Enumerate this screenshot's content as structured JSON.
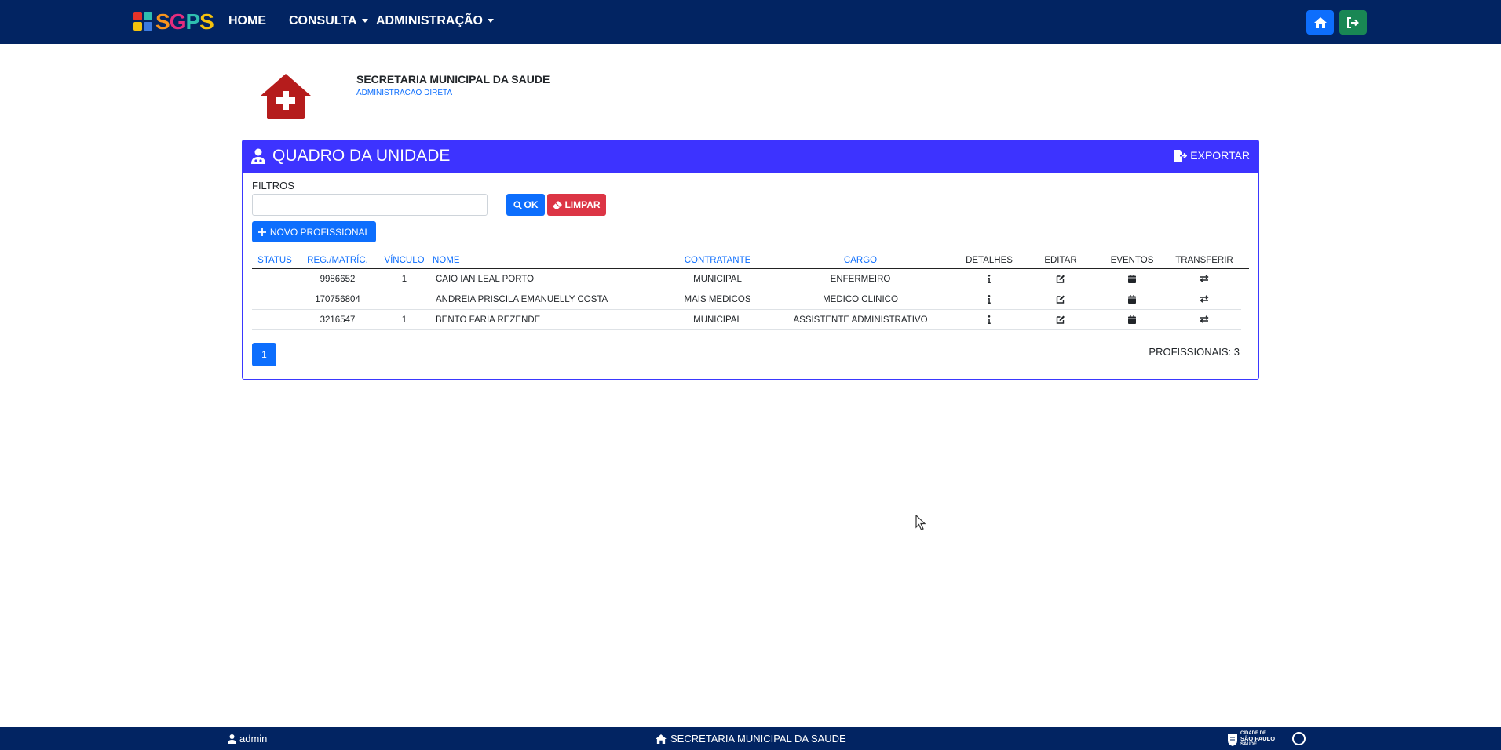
{
  "brand": {
    "name": "SGPS",
    "letter_colors": [
      "#f7941d",
      "#e52d7d",
      "#2fbfb0",
      "#f4c20d"
    ],
    "mark_colors": [
      "#e63329",
      "#2fbfb0",
      "#f4c20d",
      "#3d7be0"
    ]
  },
  "nav": {
    "home_label": "HOME",
    "consulta_label": "CONSULTA",
    "admin_label": "ADMINISTRAÇÃO",
    "home_button_color": "#0d6efd",
    "logout_button_color": "#198754"
  },
  "org": {
    "name": "SECRETARIA MUNICIPAL DA SAUDE",
    "subtitle": "ADMINISTRACAO DIRETA",
    "icon": "hospital-house-icon",
    "icon_color": "#b51c1c"
  },
  "panel": {
    "title": "QUADRO DA UNIDADE",
    "export_label": "EXPORTAR",
    "header_color": "#3d33ff"
  },
  "filters": {
    "label": "FILTROS",
    "value": "",
    "ok_label": "OK",
    "clear_label": "LIMPAR",
    "new_label": "NOVO PROFISSIONAL"
  },
  "table": {
    "headers": {
      "status": "STATUS",
      "reg": "REG./MATRÍC.",
      "vinculo": "VÍNCULO",
      "nome": "NOME",
      "contratante": "CONTRATANTE",
      "cargo": "CARGO",
      "detalhes": "DETALHES",
      "editar": "EDITAR",
      "eventos": "EVENTOS",
      "transferir": "TRANSFERIR"
    },
    "rows": [
      {
        "status": "",
        "reg": "9986652",
        "vinculo": "1",
        "nome": "CAIO IAN LEAL PORTO",
        "contratante": "MUNICIPAL",
        "cargo": "ENFERMEIRO"
      },
      {
        "status": "",
        "reg": "170756804",
        "vinculo": "",
        "nome": "ANDREIA PRISCILA EMANUELLY COSTA",
        "contratante": "MAIS MEDICOS",
        "cargo": "MEDICO CLINICO"
      },
      {
        "status": "",
        "reg": "3216547",
        "vinculo": "1",
        "nome": "BENTO FARIA REZENDE",
        "contratante": "MUNICIPAL",
        "cargo": "ASSISTENTE ADMINISTRATIVO"
      }
    ]
  },
  "pagination": {
    "current_page": "1"
  },
  "summary": {
    "count_text": "PROFISSIONAIS: 3"
  },
  "footer": {
    "user": "admin",
    "org": "SECRETARIA MUNICIPAL DA SAUDE",
    "city_logo_lines": [
      "CIDADE DE",
      "SÃO PAULO",
      "SAÚDE"
    ]
  }
}
